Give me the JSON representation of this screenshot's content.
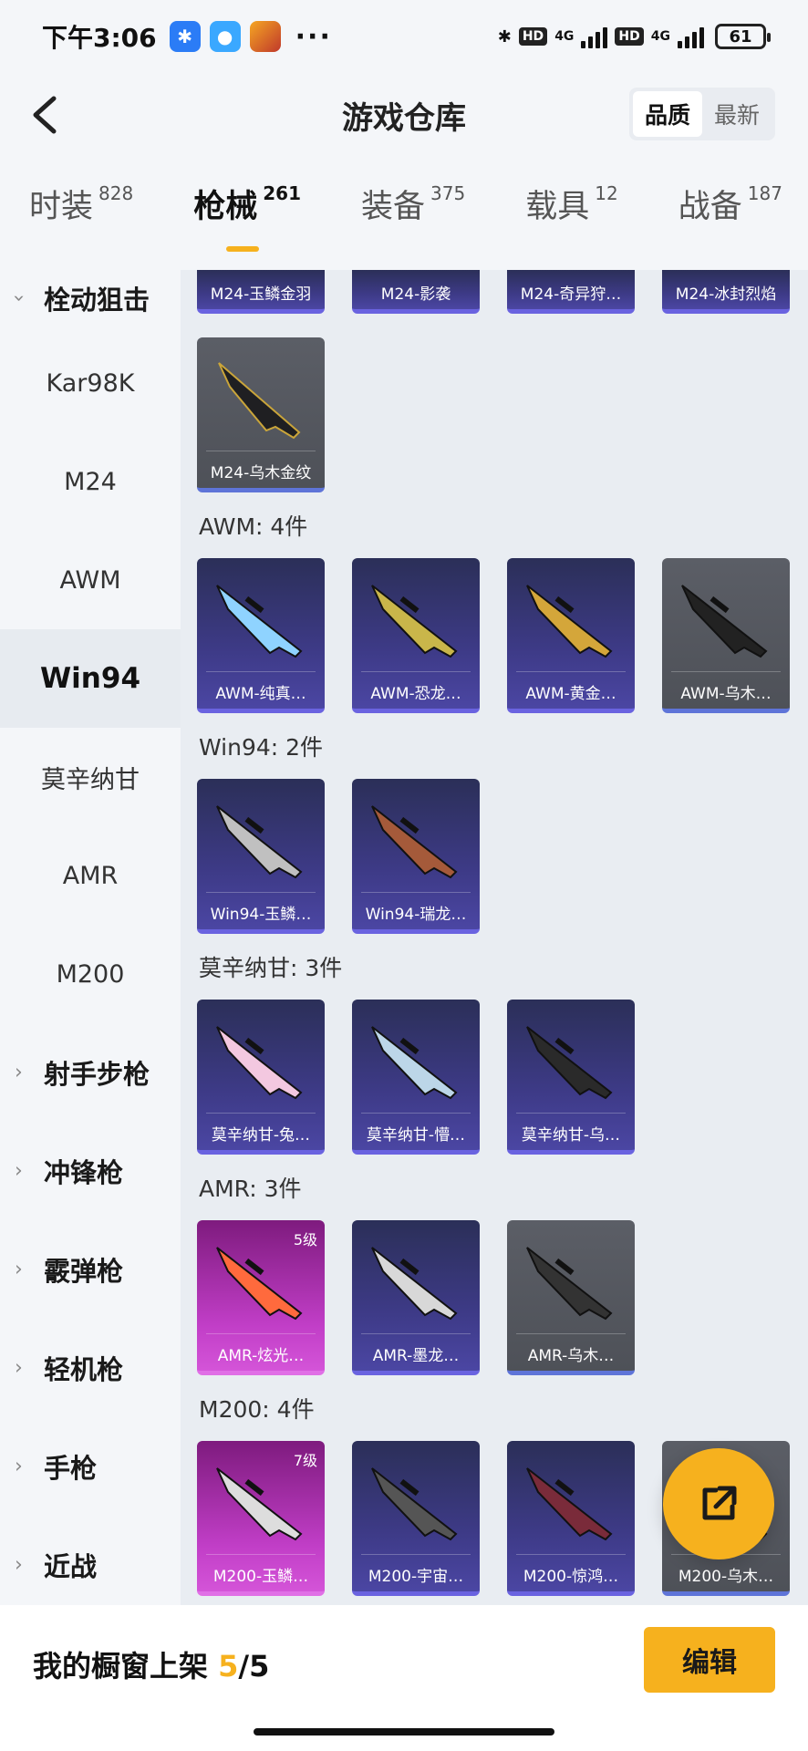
{
  "status_bar": {
    "time": "下午3:06",
    "network_a": "4G",
    "network_b": "4G",
    "hd": "HD",
    "battery": "61",
    "more": "···"
  },
  "header": {
    "title": "游戏仓库",
    "sort_options": [
      "品质",
      "最新"
    ],
    "sort_active": 0
  },
  "tabs": [
    {
      "label": "时装",
      "count": "828"
    },
    {
      "label": "枪械",
      "count": "261",
      "active": true
    },
    {
      "label": "装备",
      "count": "375"
    },
    {
      "label": "载具",
      "count": "12"
    },
    {
      "label": "战备",
      "count": "187"
    }
  ],
  "sidebar": {
    "group_open": "栓动狙击",
    "sub_items": [
      "Kar98K",
      "M24",
      "AWM",
      "Win94",
      "莫辛纳甘",
      "AMR",
      "M200"
    ],
    "selected": "Win94",
    "groups_closed": [
      "射手步枪",
      "冲锋枪",
      "霰弹枪",
      "轻机枪",
      "手枪",
      "近战"
    ]
  },
  "content": {
    "top_partial": [
      "M24-玉鳞金羽",
      "M24-影袭",
      "M24-奇异狩…",
      "M24-冰封烈焰"
    ],
    "m24_last": "M24-乌木金纹",
    "sections": [
      {
        "title": "AWM: 4件",
        "items": [
          {
            "name": "AWM-纯真…",
            "style": "purple"
          },
          {
            "name": "AWM-恐龙…",
            "style": "purple"
          },
          {
            "name": "AWM-黄金…",
            "style": "purple"
          },
          {
            "name": "AWM-乌木…",
            "style": "gray"
          }
        ]
      },
      {
        "title": "Win94: 2件",
        "items": [
          {
            "name": "Win94-玉鳞…",
            "style": "purple"
          },
          {
            "name": "Win94-瑞龙…",
            "style": "purple"
          }
        ]
      },
      {
        "title": "莫辛纳甘: 3件",
        "items": [
          {
            "name": "莫辛纳甘-兔…",
            "style": "purple"
          },
          {
            "name": "莫辛纳甘-懵…",
            "style": "purple"
          },
          {
            "name": "莫辛纳甘-乌…",
            "style": "purple"
          }
        ]
      },
      {
        "title": "AMR: 3件",
        "items": [
          {
            "name": "AMR-炫光…",
            "style": "pink",
            "level": "5级"
          },
          {
            "name": "AMR-墨龙…",
            "style": "purple"
          },
          {
            "name": "AMR-乌木…",
            "style": "gray"
          }
        ]
      },
      {
        "title": "M200: 4件",
        "items": [
          {
            "name": "M200-玉鳞…",
            "style": "pink",
            "level": "7级"
          },
          {
            "name": "M200-宇宙…",
            "style": "purple"
          },
          {
            "name": "M200-惊鸿…",
            "style": "purple"
          },
          {
            "name": "M200-乌木…",
            "style": "gray"
          }
        ]
      }
    ]
  },
  "bottom": {
    "shelf_label": "我的橱窗上架 ",
    "shelf_current": "5",
    "shelf_total": "/5",
    "edit_label": "编辑"
  },
  "colors": {
    "accent": "#f6b11e",
    "card_purple": "#3d3a86",
    "card_pink": "#c13ec7",
    "card_gray": "#55585f"
  }
}
